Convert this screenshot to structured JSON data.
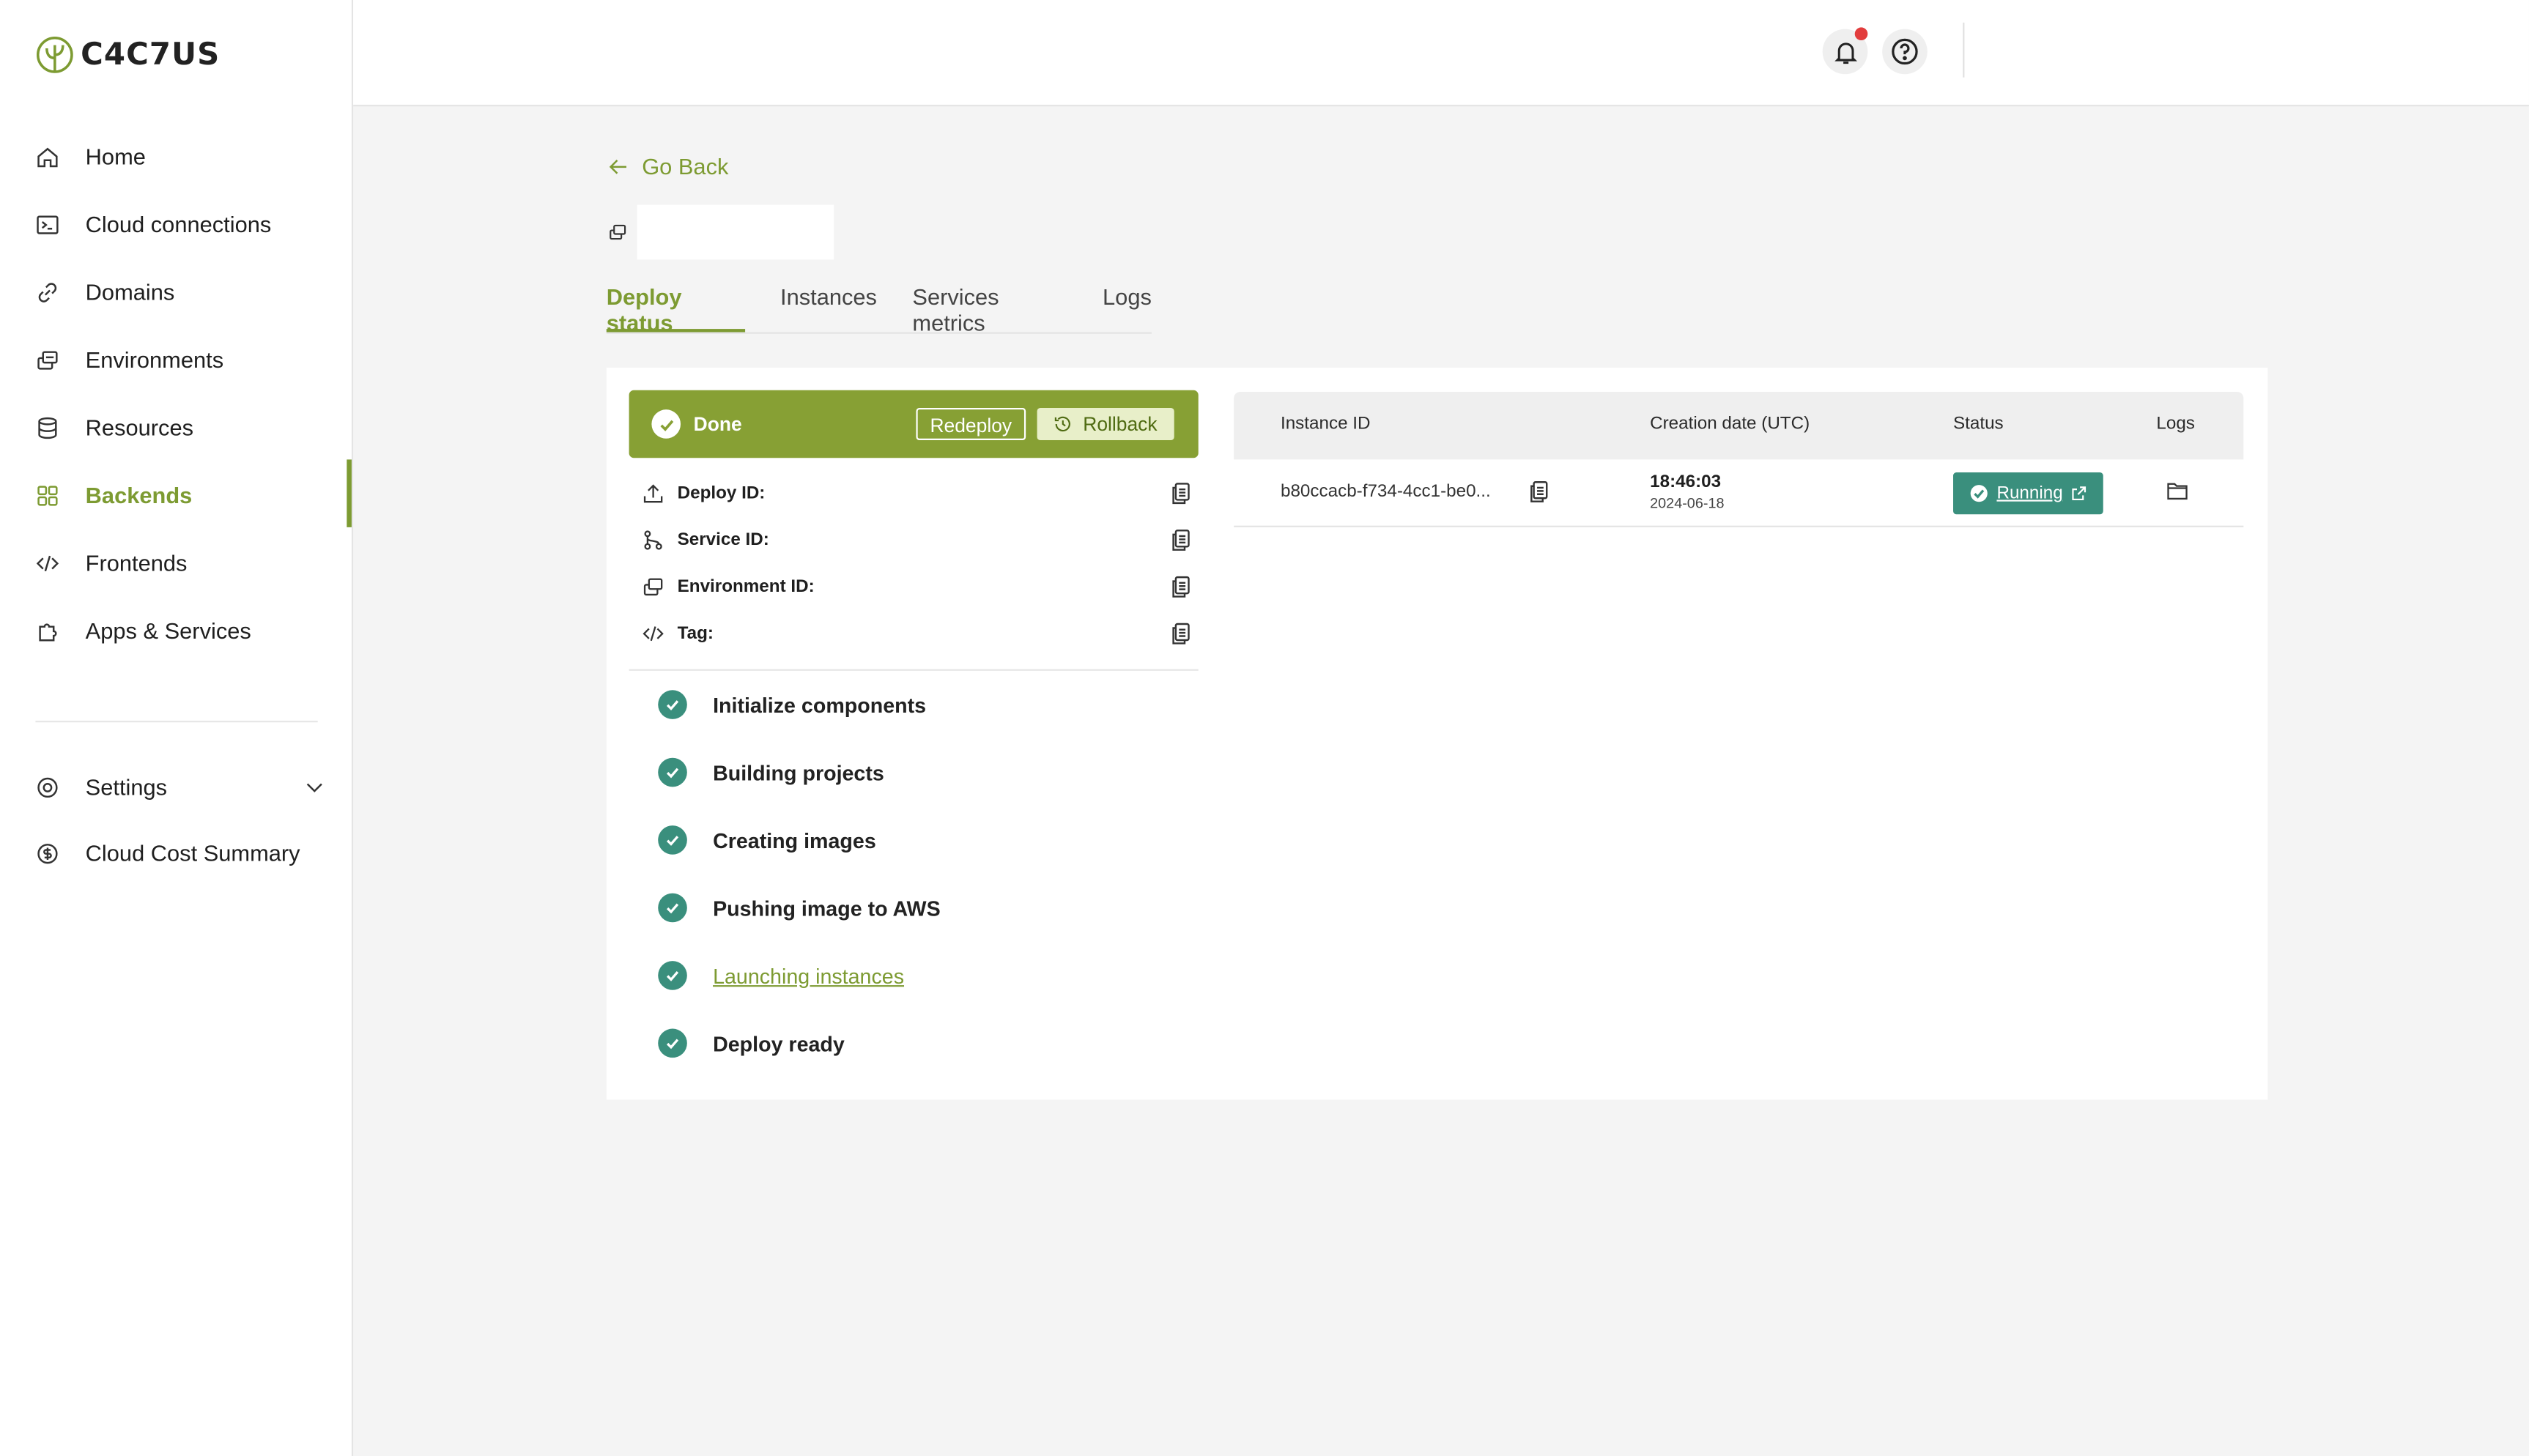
{
  "brand": {
    "logo_text": "C4C7US"
  },
  "sidebar": {
    "items": [
      {
        "label": "Home",
        "icon": "home-icon"
      },
      {
        "label": "Cloud connections",
        "icon": "terminal-icon"
      },
      {
        "label": "Domains",
        "icon": "link-icon"
      },
      {
        "label": "Environments",
        "icon": "environments-icon"
      },
      {
        "label": "Resources",
        "icon": "database-icon"
      },
      {
        "label": "Backends",
        "icon": "grid-icon",
        "active": true
      },
      {
        "label": "Frontends",
        "icon": "code-icon"
      },
      {
        "label": "Apps & Services",
        "icon": "puzzle-icon"
      }
    ],
    "bottom_items": [
      {
        "label": "Settings",
        "icon": "gear-icon"
      },
      {
        "label": "Cloud Cost Summary",
        "icon": "dollar-icon"
      }
    ]
  },
  "topbar": {
    "notifications_icon": "bell-icon",
    "help_icon": "help-icon"
  },
  "page": {
    "go_back": "Go Back",
    "title": "",
    "tabs": [
      "Deploy status",
      "Instances",
      "Services metrics",
      "Logs"
    ],
    "active_tab": "Deploy status"
  },
  "deploy": {
    "status": "Done",
    "redeploy_label": "Redeploy",
    "rollback_label": "Rollback",
    "meta": [
      {
        "label": "Deploy ID:",
        "value": ""
      },
      {
        "label": "Service ID:",
        "value": ""
      },
      {
        "label": "Environment ID:",
        "value": ""
      },
      {
        "label": "Tag:",
        "value": ""
      }
    ],
    "steps": [
      {
        "label": "Initialize components",
        "done": true
      },
      {
        "label": "Building projects",
        "done": true
      },
      {
        "label": "Creating images",
        "done": true
      },
      {
        "label": "Pushing image to AWS",
        "done": true
      },
      {
        "label": "Launching instances",
        "done": true,
        "link": true
      },
      {
        "label": "Deploy ready",
        "done": true
      }
    ]
  },
  "instances_table": {
    "columns": [
      "Instance ID",
      "Creation date (UTC)",
      "Status",
      "Logs"
    ],
    "rows": [
      {
        "instance_id": "b80ccacb-f734-4cc1-be0...",
        "time": "18:46:03",
        "date": "2024-06-18",
        "status": "Running"
      }
    ]
  },
  "colors": {
    "accent": "#7d9b32",
    "success": "#3a8f7d",
    "notification_dot": "#e23c3c"
  }
}
